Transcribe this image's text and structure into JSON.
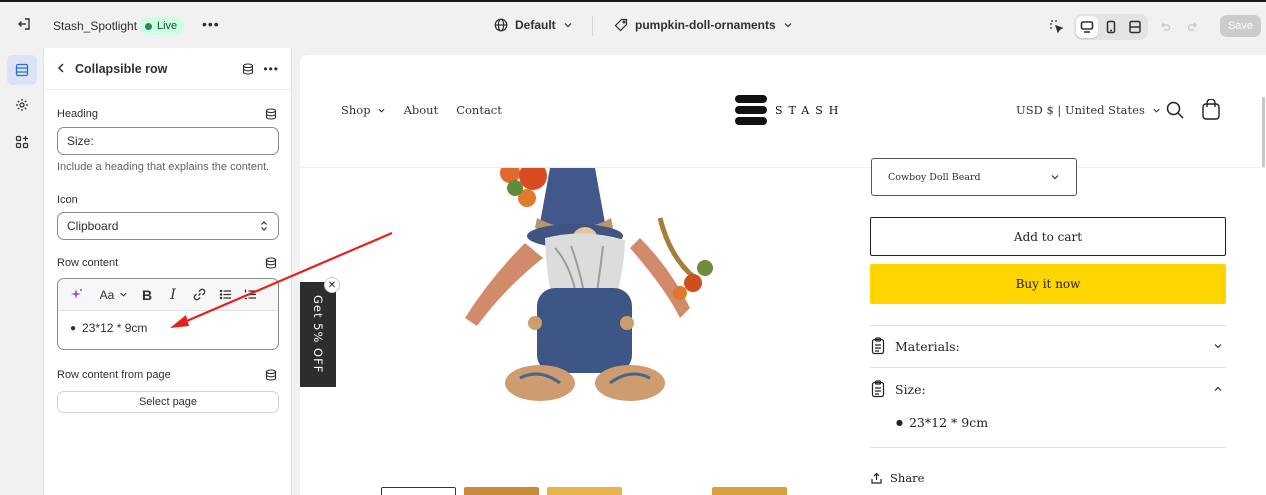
{
  "topbar": {
    "store_name": "Stash_Spotlight",
    "status": "Live",
    "theme": "Default",
    "page": "pumpkin-doll-ornaments",
    "save_label": "Save"
  },
  "panel": {
    "title": "Collapsible row",
    "heading_label": "Heading",
    "heading_value": "Size:",
    "heading_help": "Include a heading that explains the content.",
    "icon_label": "Icon",
    "icon_value": "Clipboard",
    "row_content_label": "Row content",
    "rte_font_label": "Aa",
    "row_content_item": "23*12 * 9cm",
    "row_content_from_page_label": "Row content from page",
    "select_page_label": "Select page"
  },
  "store": {
    "nav": [
      "Shop",
      "About",
      "Contact"
    ],
    "logo_text": "STASH",
    "locale": "USD $ | United States",
    "variant_value": "Cowboy Doll Beard",
    "add_to_cart": "Add to cart",
    "buy_now": "Buy it now",
    "accordions": [
      {
        "label": "Materials:",
        "expanded": false
      },
      {
        "label": "Size:",
        "expanded": true
      }
    ],
    "size_item": "23*12 * 9cm",
    "share": "Share",
    "popup_tab": "Get 5% OFF"
  },
  "colors": {
    "buy_button": "#ffd500",
    "live_badge_bg": "#cdfee1",
    "live_badge_dot": "#29845a",
    "annotation_arrow": "#e8201c",
    "active_rail": "#dbe3f4"
  }
}
